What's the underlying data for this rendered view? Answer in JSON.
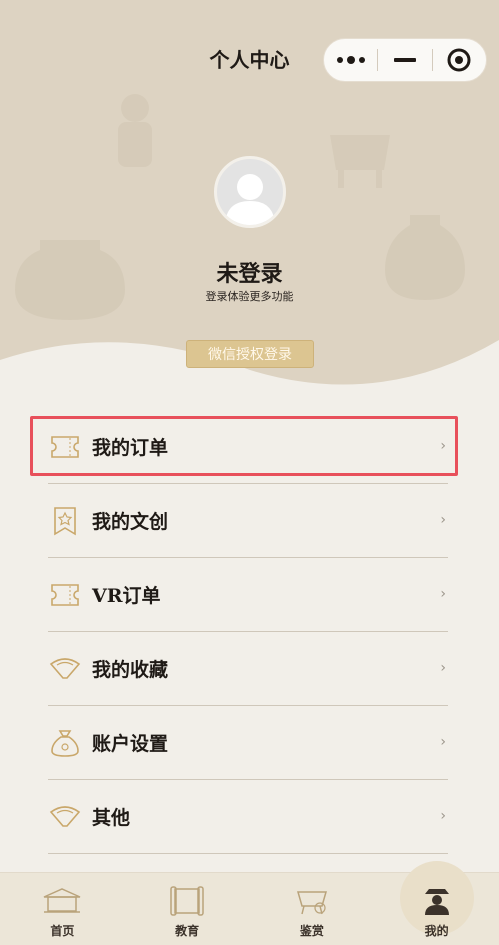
{
  "header": {
    "title": "个人中心"
  },
  "profile": {
    "status": "未登录",
    "hint": "登录体验更多功能",
    "auth_button": "微信授权登录"
  },
  "menu": {
    "items": [
      {
        "label": "我的订单",
        "icon": "ticket-icon"
      },
      {
        "label": "我的文创",
        "icon": "star-badge-icon"
      },
      {
        "label": "VR订单",
        "icon": "ticket-icon"
      },
      {
        "label": "我的收藏",
        "icon": "fan-icon"
      },
      {
        "label": "账户设置",
        "icon": "money-bag-icon"
      },
      {
        "label": "其他",
        "icon": "fan-icon"
      }
    ],
    "chevron": "›"
  },
  "tabbar": {
    "items": [
      {
        "label": "首页",
        "icon": "palace-icon"
      },
      {
        "label": "教育",
        "icon": "scroll-icon"
      },
      {
        "label": "鉴赏",
        "icon": "bronze-vessel-icon"
      },
      {
        "label": "我的",
        "icon": "scholar-icon"
      }
    ],
    "active_index": 3
  },
  "colors": {
    "accent_gold": "#dcc591",
    "highlight_red": "#e8505b",
    "hero_bg": "#ddd3c2"
  }
}
